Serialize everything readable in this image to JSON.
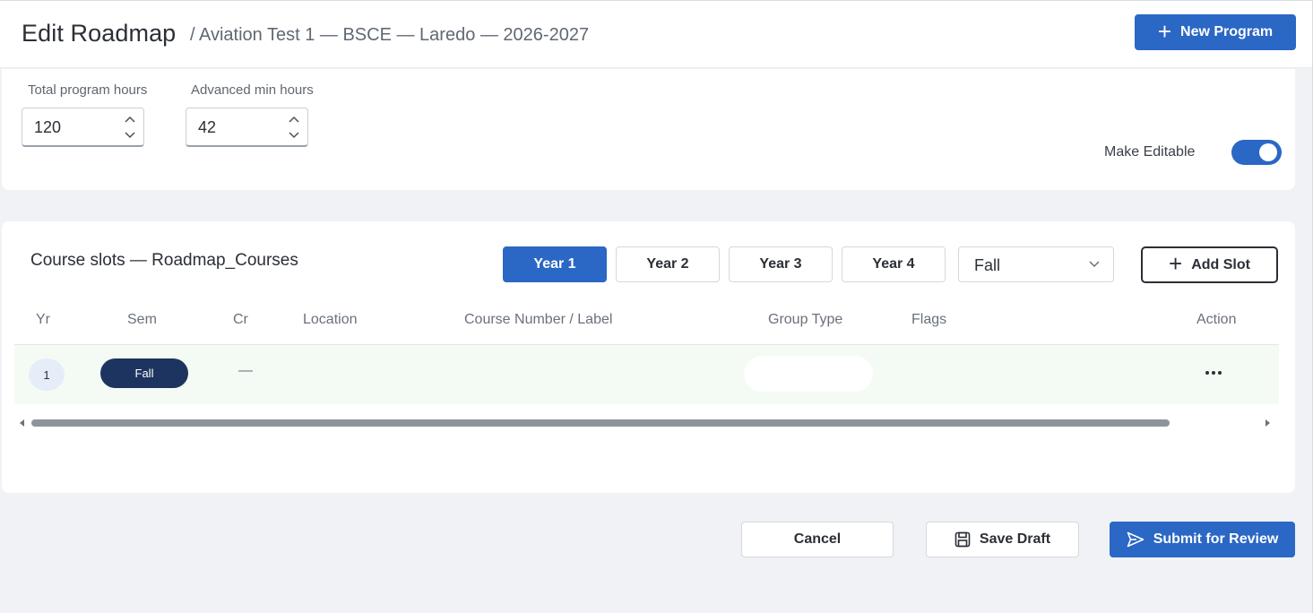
{
  "header": {
    "title": "Edit Roadmap",
    "breadcrumb": "/  Aviation Test 1 — BSCE — Laredo — 2026-2027",
    "new_program_label": "New Program",
    "new_program_icon": "plus-icon"
  },
  "settings": {
    "total_hours_label": "Total program hours",
    "total_hours_value": "120",
    "advanced_hours_label": "Advanced min hours",
    "advanced_hours_value": "42",
    "make_editable_label": "Make Editable",
    "make_editable_on": true
  },
  "course_slots": {
    "title": "Course slots — Roadmap_Courses",
    "year_tabs": [
      {
        "label": "Year 1",
        "active": true
      },
      {
        "label": "Year 2",
        "active": false
      },
      {
        "label": "Year 3",
        "active": false
      },
      {
        "label": "Year 4",
        "active": false
      }
    ],
    "semester_selected": "Fall",
    "add_slot_label": "Add Slot",
    "columns": [
      "Yr",
      "Sem",
      "Cr",
      "Location",
      "Course Number / Label",
      "Group Type",
      "Flags",
      "Action"
    ],
    "rows": [
      {
        "yr": "1",
        "sem": "Fall",
        "cr": "—",
        "location": "",
        "course": "",
        "group_type": "",
        "flags": ""
      }
    ]
  },
  "footer": {
    "cancel_label": "Cancel",
    "save_draft_label": "Save Draft",
    "submit_label": "Submit for Review"
  },
  "colors": {
    "primary": "#2b67c4",
    "navy_pill": "#1e3460",
    "row_highlight": "#f4faf4",
    "background": "#f0f2f6"
  }
}
